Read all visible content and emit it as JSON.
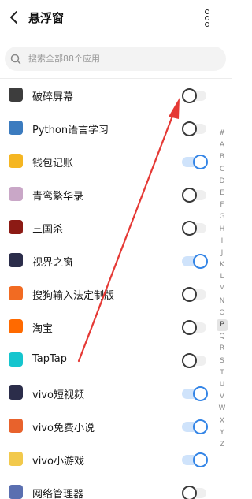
{
  "header": {
    "title": "悬浮窗",
    "back_icon": "back-arrow-icon",
    "more_icon": "more-vertical-icon"
  },
  "search": {
    "placeholder": "搜索全部88个应用",
    "value": "",
    "icon": "search-icon"
  },
  "apps": [
    {
      "name": "破碎屏幕",
      "enabled": false,
      "icon": "broken-screen-app-icon",
      "color": "#3d3d3d"
    },
    {
      "name": "Python语言学习",
      "enabled": false,
      "icon": "python-app-icon",
      "color": "#3b7bbf"
    },
    {
      "name": "钱包记账",
      "enabled": true,
      "icon": "wallet-app-icon",
      "color": "#f5b622"
    },
    {
      "name": "青鸾繁华录",
      "enabled": false,
      "icon": "qingluan-game-icon",
      "color": "#c9a7c7"
    },
    {
      "name": "三国杀",
      "enabled": false,
      "icon": "sanguosha-app-icon",
      "color": "#8c1a14"
    },
    {
      "name": "视界之窗",
      "enabled": true,
      "icon": "play-window-app-icon",
      "color": "#2b2d4a"
    },
    {
      "name": "搜狗输入法定制版",
      "enabled": false,
      "icon": "sogou-ime-app-icon",
      "color": "#f26b22"
    },
    {
      "name": "淘宝",
      "enabled": false,
      "icon": "taobao-app-icon",
      "color": "#ff6a00"
    },
    {
      "name": "TapTap",
      "enabled": false,
      "icon": "taptap-app-icon",
      "color": "#15c5ce"
    },
    {
      "name": "vivo短视频",
      "enabled": true,
      "icon": "vivo-video-app-icon",
      "color": "#2b2d4a"
    },
    {
      "name": "vivo免费小说",
      "enabled": true,
      "icon": "vivo-novel-app-icon",
      "color": "#e8622c"
    },
    {
      "name": "vivo小游戏",
      "enabled": true,
      "icon": "vivo-minigame-app-icon",
      "color": "#f2c94c"
    },
    {
      "name": "网络管理器",
      "enabled": false,
      "icon": "network-manager-app-icon",
      "color": "#5a6fb0"
    }
  ],
  "index_letters": [
    "#",
    "A",
    "B",
    "C",
    "D",
    "E",
    "F",
    "G",
    "H",
    "I",
    "J",
    "K",
    "L",
    "M",
    "N",
    "O",
    "P",
    "Q",
    "R",
    "S",
    "T",
    "U",
    "V",
    "W",
    "X",
    "Y",
    "Z"
  ],
  "index_active": "P",
  "colors": {
    "accent": "#3485e6",
    "annotation_arrow": "#e53935"
  }
}
